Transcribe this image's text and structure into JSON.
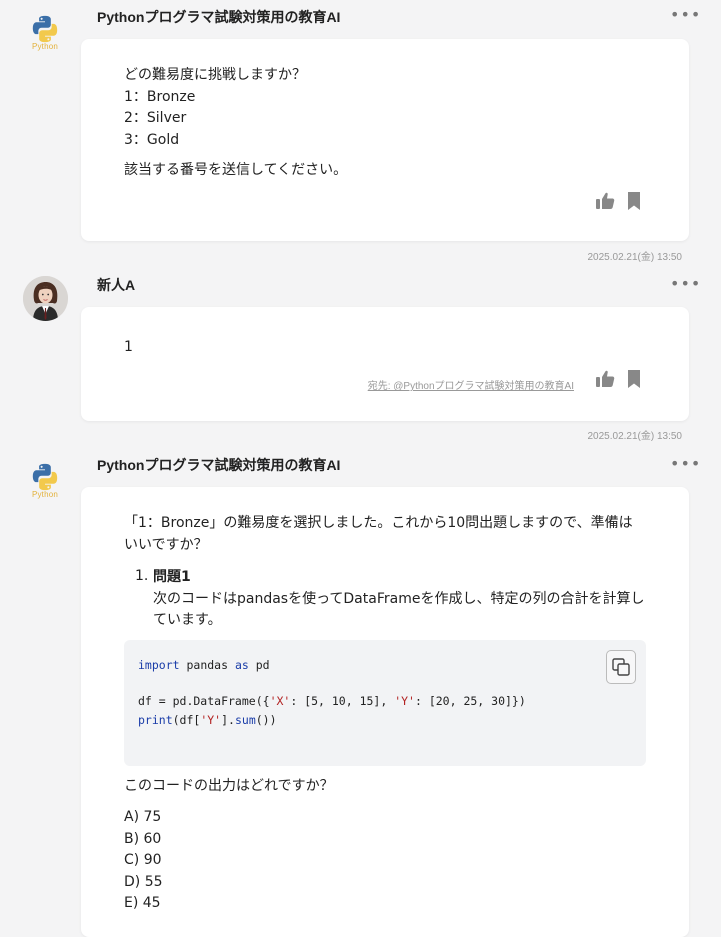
{
  "messages": [
    {
      "sender": "Pythonプログラマ試験対策用の教育AI",
      "avatar_label": "Python",
      "lines": [
        "どの難易度に挑戦しますか？",
        "1：Bronze",
        "2：Silver",
        "3：Gold"
      ],
      "footer_line": "該当する番号を送信してください。",
      "timestamp": "2025.02.21(金) 13:50"
    },
    {
      "sender": "新人A",
      "text": "1",
      "mention": "宛先: @Pythonプログラマ試験対策用の教育AI",
      "timestamp": "2025.02.21(金) 13:50"
    },
    {
      "sender": "Pythonプログラマ試験対策用の教育AI",
      "avatar_label": "Python",
      "intro": [
        "「1：Bronze」の難易度を選択しました。これから10問出題しますので、準備は",
        "いいですか？"
      ],
      "question_number": "1.",
      "question_title": "問題1",
      "question_text": [
        "次のコードはpandasを使ってDataFrameを作成し、特定の列の合計を計算し",
        "ています。"
      ],
      "code_lines": [
        "import pandas as pd",
        "",
        "df = pd.DataFrame({'X': [5, 10, 15], 'Y': [20, 25, 30]})",
        "print(df['Y'].sum())"
      ],
      "prompt": "このコードの出力はどれですか？",
      "choices": [
        "A) 75",
        "B) 60",
        "C) 90",
        "D) 55",
        "E) 45"
      ]
    }
  ],
  "colors": {
    "accent": "#1a3ca8",
    "string": "#b22222",
    "py_blue": "#3b6fa8",
    "py_yellow": "#f2c94c"
  },
  "icons": [
    "python-logo-icon",
    "more-icon",
    "thumbs-up-icon",
    "bookmark-icon",
    "copy-icon"
  ]
}
